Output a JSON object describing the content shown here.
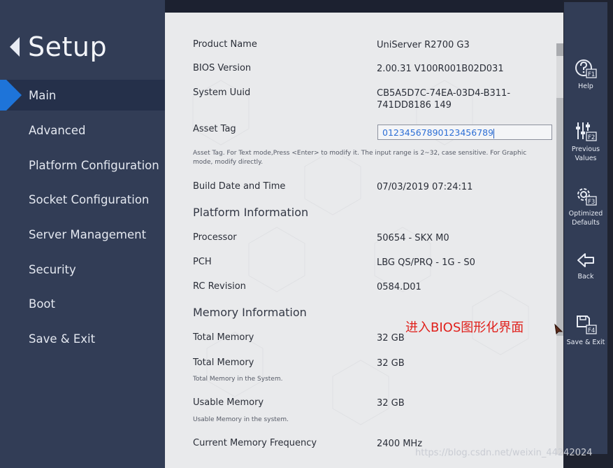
{
  "sidebar": {
    "title": "Setup",
    "items": [
      {
        "label": "Main",
        "active": true
      },
      {
        "label": "Advanced"
      },
      {
        "label": "Platform Configuration"
      },
      {
        "label": "Socket Configuration"
      },
      {
        "label": "Server Management"
      },
      {
        "label": "Security"
      },
      {
        "label": "Boot"
      },
      {
        "label": "Save & Exit"
      }
    ]
  },
  "main": {
    "product_name_label": "Product Name",
    "product_name_value": "UniServer R2700 G3",
    "bios_version_label": "BIOS Version",
    "bios_version_value": "2.00.31 V100R001B02D031",
    "system_uuid_label": "System Uuid",
    "system_uuid_value": "CB5A5D7C-74EA-03D4-B311-741DD8186 149",
    "asset_tag_label": "Asset Tag",
    "asset_tag_value": "01234567890123456789",
    "asset_tag_help": "Asset Tag. For Text mode,Press <Enter> to modify it. The input range is 2~32, case sensitive. For Graphic mode, modify directly.",
    "build_date_label": "Build Date and Time",
    "build_date_value": "07/03/2019 07:24:11",
    "platform_section": "Platform Information",
    "processor_label": "Processor",
    "processor_value": "50654 - SKX M0",
    "pch_label": "PCH",
    "pch_value": "LBG QS/PRQ - 1G - S0",
    "rc_label": "RC Revision",
    "rc_value": "0584.D01",
    "memory_section": "Memory Information",
    "total_mem_label": "Total Memory",
    "total_mem_value": "32 GB",
    "total_mem2_label": "Total Memory",
    "total_mem2_value": "32 GB",
    "total_mem2_help": "Total Memory in the System.",
    "usable_mem_label": "Usable Memory",
    "usable_mem_value": "32 GB",
    "usable_mem_help": "Usable Memory in the system.",
    "freq_label": "Current Memory Frequency",
    "freq_value": "2400 MHz"
  },
  "actions": {
    "help": {
      "label": "Help",
      "key": "F1",
      "icon": "help-icon"
    },
    "previous": {
      "label": "Previous Values",
      "key": "F2",
      "icon": "sliders-icon"
    },
    "optimized": {
      "label": "Optimized Defaults",
      "key": "F3",
      "icon": "gear-icon"
    },
    "back": {
      "label": "Back",
      "icon": "back-arrow-icon"
    },
    "save_exit": {
      "label": "Save & Exit",
      "key": "F4",
      "icon": "save-exit-icon"
    }
  },
  "annotation": "进入BIOS图形化界面",
  "watermark": "https://blog.csdn.net/weixin_44242024",
  "colors": {
    "sidebar_bg": "#323d56",
    "active_marker": "#1e74d9",
    "panel_bg": "#e9eaec",
    "annotation": "#e0201b",
    "asset_value": "#2d6fd6"
  }
}
